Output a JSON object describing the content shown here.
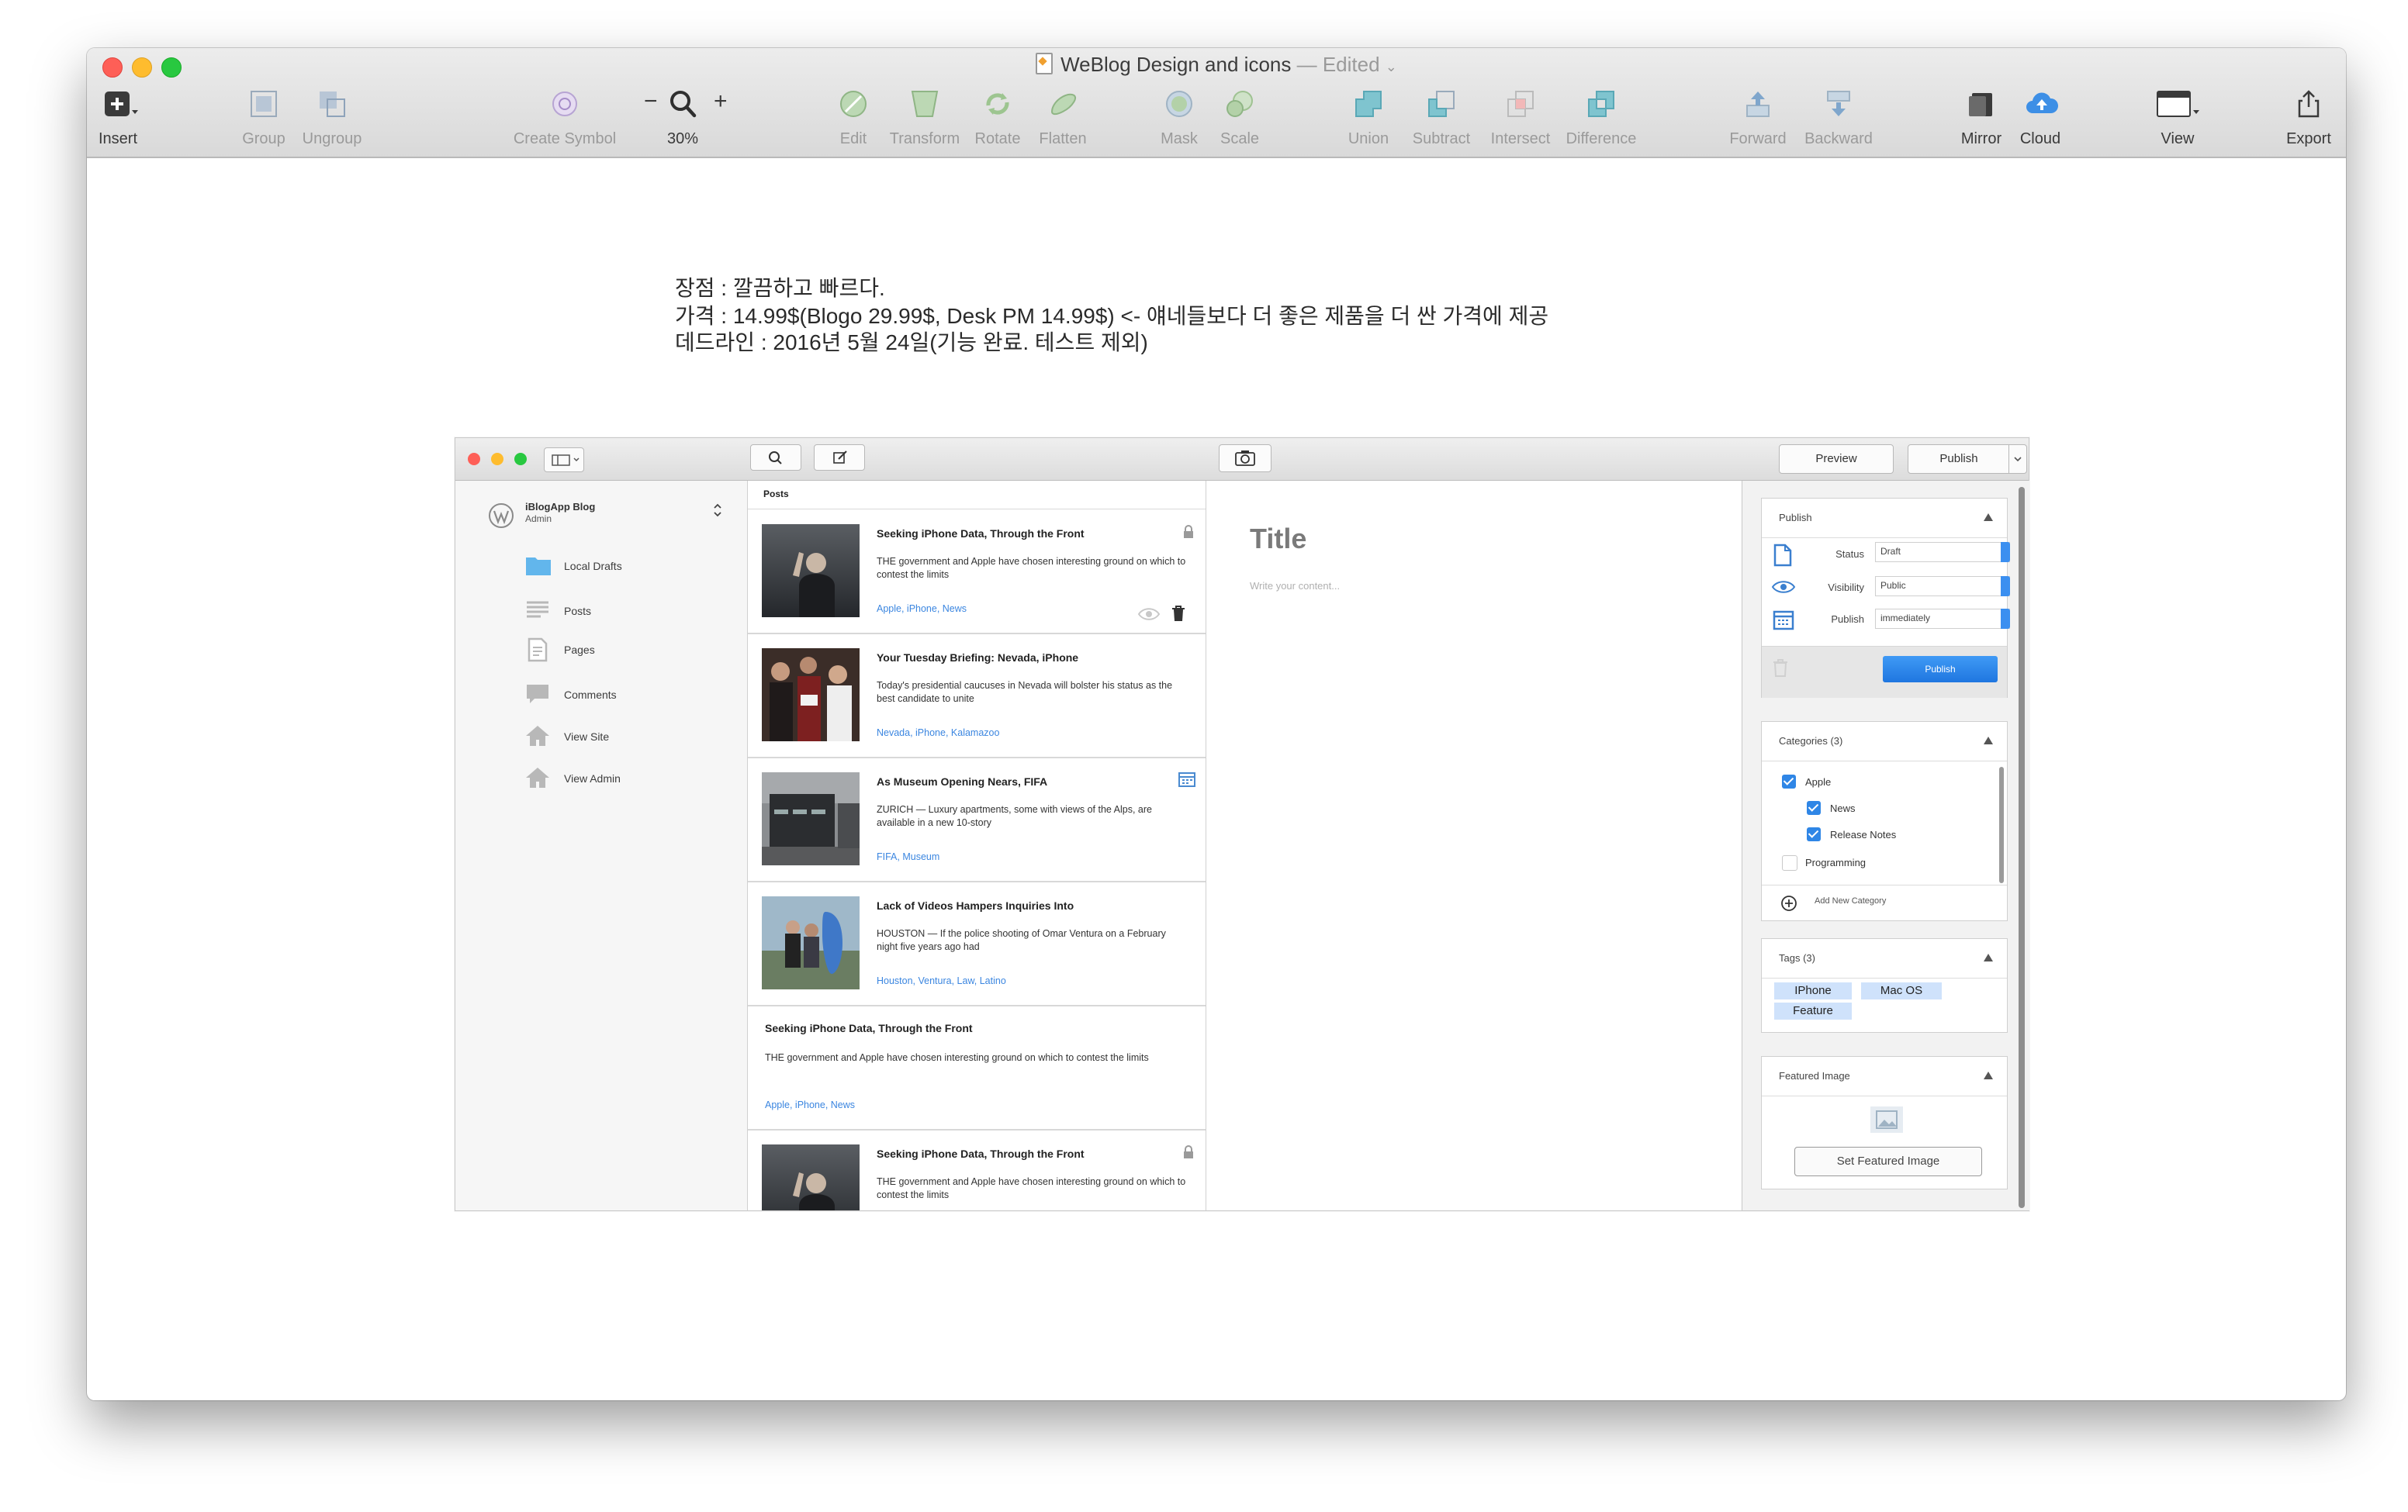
{
  "app": {
    "window_title": "WeBlog Design and icons",
    "edited_label": "— Edited",
    "toolbar": {
      "insert": "Insert",
      "group": "Group",
      "ungroup": "Ungroup",
      "create_symbol": "Create Symbol",
      "zoom_minus": "−",
      "zoom_plus": "+",
      "zoom_level": "30%",
      "edit": "Edit",
      "transform": "Transform",
      "rotate": "Rotate",
      "flatten": "Flatten",
      "mask": "Mask",
      "scale": "Scale",
      "union": "Union",
      "subtract": "Subtract",
      "intersect": "Intersect",
      "difference": "Difference",
      "forward": "Forward",
      "backward": "Backward",
      "mirror": "Mirror",
      "cloud": "Cloud",
      "view": "View",
      "export": "Export"
    }
  },
  "canvas_note": {
    "line1": "장점 : 깔끔하고 빠르다.",
    "line2": "가격 : 14.99$(Blogo 29.99$, Desk PM 14.99$) <- 얘네들보다 더 좋은 제품을 더 싼 가격에 제공",
    "line3": "데드라인 : 2016년 5월 24일(기능 완료. 테스트 제외)"
  },
  "mockup": {
    "toolbar": {
      "preview": "Preview",
      "publish": "Publish"
    },
    "blog": {
      "name": "iBlogApp Blog",
      "role": "Admin"
    },
    "sidebar": [
      {
        "label": "Local Drafts",
        "icon": "folder-icon"
      },
      {
        "label": "Posts",
        "icon": "posts-list-icon"
      },
      {
        "label": "Pages",
        "icon": "page-icon"
      },
      {
        "label": "Comments",
        "icon": "comment-icon"
      },
      {
        "label": "View Site",
        "icon": "home-icon"
      },
      {
        "label": "View Admin",
        "icon": "home-icon"
      }
    ],
    "posts_header": "Posts",
    "posts": [
      {
        "title": "Seeking iPhone Data, Through the Front",
        "excerpt": "THE government and Apple have chosen interesting ground on which to contest the limits",
        "tags": "Apple, iPhone, News"
      },
      {
        "title": "Your Tuesday Briefing: Nevada, iPhone",
        "excerpt": "Today's presidential caucuses in Nevada will bolster his status as the best candidate to unite",
        "tags": "Nevada, iPhone, Kalamazoo"
      },
      {
        "title": "As Museum Opening Nears, FIFA",
        "excerpt": "ZURICH — Luxury apartments, some with views of the Alps, are available in a new 10-story",
        "tags": "FIFA, Museum"
      },
      {
        "title": "Lack of Videos Hampers Inquiries Into",
        "excerpt": "HOUSTON — If the police shooting of Omar Ventura on a February night five years ago had",
        "tags": "Houston, Ventura, Law, Latino"
      },
      {
        "title": "Seeking iPhone Data, Through the Front",
        "excerpt": "THE government and Apple have chosen interesting ground on which to contest the limits",
        "tags": "Apple, iPhone, News"
      },
      {
        "title": "Seeking iPhone Data, Through the Front",
        "excerpt": "THE government and Apple have chosen interesting ground on which to contest the limits",
        "tags": ""
      }
    ],
    "editor": {
      "title_placeholder": "Title",
      "content_placeholder": "Write your content..."
    },
    "publish_panel": {
      "header": "Publish",
      "status_label": "Status",
      "status_value": "Draft",
      "visibility_label": "Visibility",
      "visibility_value": "Public",
      "publish_label": "Publish",
      "publish_value": "immediately",
      "publish_button": "Publish"
    },
    "categories_panel": {
      "header": "Categories (3)",
      "items": [
        {
          "label": "Apple",
          "checked": true
        },
        {
          "label": "News",
          "checked": true
        },
        {
          "label": "Release Notes",
          "checked": true
        },
        {
          "label": "Programming",
          "checked": false
        }
      ],
      "add_new": "Add New Category"
    },
    "tags_panel": {
      "header": "Tags (3)",
      "tags": [
        "IPhone",
        "Mac OS",
        "Feature"
      ]
    },
    "featured_panel": {
      "header": "Featured Image",
      "button": "Set Featured Image"
    }
  },
  "colors": {
    "accent_blue": "#2f86e6",
    "tag_blue": "#3b86e0",
    "traffic_red": "#fe5f57",
    "traffic_yellow": "#febc2e",
    "traffic_green": "#28c840"
  }
}
